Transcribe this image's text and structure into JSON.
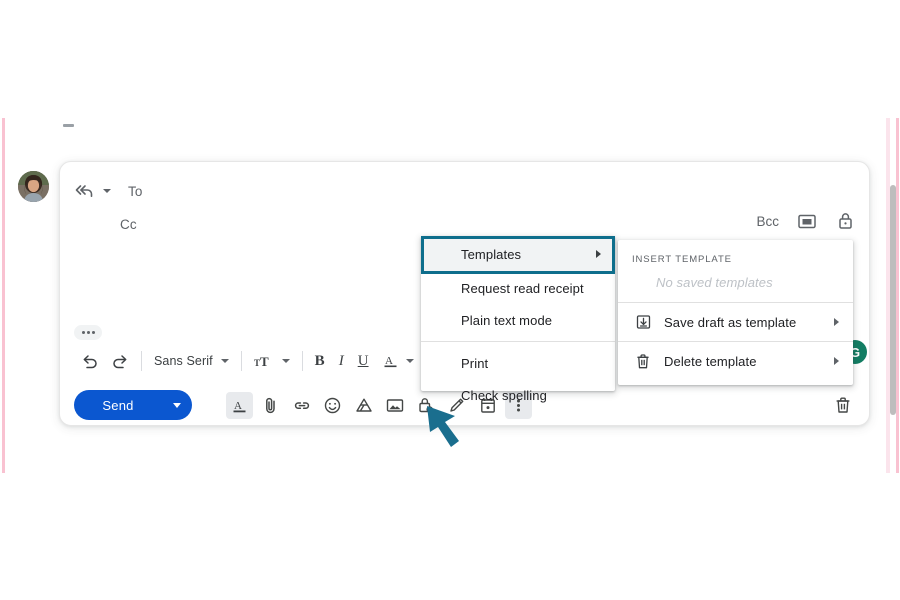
{
  "compose": {
    "to_label": "To",
    "cc_label": "Cc",
    "bcc_label": "Bcc",
    "reply_all_icon": "reply-all-icon",
    "popout_icon": "popout-window-icon",
    "lock_icon": "lock-icon",
    "trimmed_content_icon": "ellipsis-pill-icon"
  },
  "format_toolbar": {
    "undo_icon": "undo-icon",
    "redo_icon": "redo-icon",
    "font_family": "Sans Serif",
    "font_size_icon": "font-size-icon",
    "bold": "B",
    "italic": "I",
    "underline": "U",
    "text_color": "A",
    "align_icon": "align-icon"
  },
  "bottom_toolbar": {
    "send_label": "Send",
    "send_options_icon": "chevron-up-icon",
    "formatting_icon": "formatting-options-icon",
    "attach_icon": "attach-file-icon",
    "link_icon": "insert-link-icon",
    "emoji_icon": "insert-emoji-icon",
    "drive_icon": "insert-drive-file-icon",
    "image_icon": "insert-photo-icon",
    "confidential_icon": "confidential-mode-icon",
    "signature_icon": "insert-signature-icon",
    "schedule_icon": "schedule-send-icon",
    "more_options_icon": "more-options-icon",
    "discard_icon": "discard-draft-icon",
    "account_badge": "G"
  },
  "menu": {
    "items": [
      {
        "label": "Templates",
        "has_submenu": true,
        "highlighted": true
      },
      {
        "label": "Request read receipt",
        "has_submenu": false,
        "highlighted": false
      },
      {
        "label": "Plain text mode",
        "has_submenu": false,
        "highlighted": false
      },
      {
        "label": "Print",
        "has_submenu": false,
        "highlighted": false
      },
      {
        "label": "Check spelling",
        "has_submenu": false,
        "highlighted": false
      }
    ]
  },
  "submenu": {
    "section_header": "INSERT TEMPLATE",
    "empty_state": "No saved templates",
    "items": [
      {
        "label": "Save draft as template",
        "icon": "save-template-icon",
        "has_submenu": true
      },
      {
        "label": "Delete template",
        "icon": "trash-icon",
        "has_submenu": true
      }
    ]
  },
  "annotation": {
    "arrow_color": "#1a6e8e",
    "highlight_color": "#0e6e8c",
    "points_to": "more-options-icon"
  },
  "colors": {
    "send_blue": "#0b57d0",
    "page_rail_pink": "#f9c2d1",
    "badge_green": "#137d63"
  }
}
